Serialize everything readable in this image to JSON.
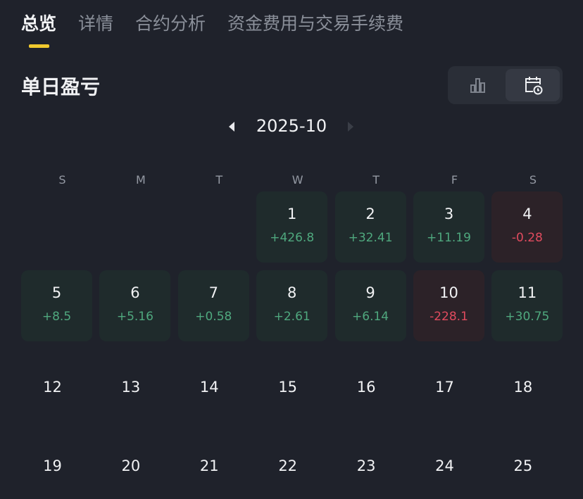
{
  "tabs": [
    "总览",
    "详情",
    "合约分析",
    "资金费用与交易手续费"
  ],
  "section_title": "单日盈亏",
  "view_toggle": {
    "options": [
      "bar-chart-icon",
      "calendar-clock-icon"
    ],
    "selected": 1
  },
  "month": "2025-10",
  "weekdays": [
    "S",
    "M",
    "T",
    "W",
    "T",
    "F",
    "S"
  ],
  "colors": {
    "accent": "#f0c92e",
    "profit": "#4fa87e",
    "loss": "#e04b5e"
  },
  "days": [
    {
      "day": "1",
      "pnl": "+426.8",
      "type": "g"
    },
    {
      "day": "2",
      "pnl": "+32.41",
      "type": "g"
    },
    {
      "day": "3",
      "pnl": "+11.19",
      "type": "g"
    },
    {
      "day": "4",
      "pnl": "-0.28",
      "type": "r"
    },
    {
      "day": "5",
      "pnl": "+8.5",
      "type": "g"
    },
    {
      "day": "6",
      "pnl": "+5.16",
      "type": "g"
    },
    {
      "day": "7",
      "pnl": "+0.58",
      "type": "g"
    },
    {
      "day": "8",
      "pnl": "+2.61",
      "type": "g"
    },
    {
      "day": "9",
      "pnl": "+6.14",
      "type": "g"
    },
    {
      "day": "10",
      "pnl": "-228.1",
      "type": "r"
    },
    {
      "day": "11",
      "pnl": "+30.75",
      "type": "g"
    },
    {
      "day": "12"
    },
    {
      "day": "13"
    },
    {
      "day": "14"
    },
    {
      "day": "15"
    },
    {
      "day": "16"
    },
    {
      "day": "17"
    },
    {
      "day": "18"
    },
    {
      "day": "19"
    },
    {
      "day": "20"
    },
    {
      "day": "21"
    },
    {
      "day": "22"
    },
    {
      "day": "23"
    },
    {
      "day": "24"
    },
    {
      "day": "25"
    }
  ],
  "first_weekday": 3
}
